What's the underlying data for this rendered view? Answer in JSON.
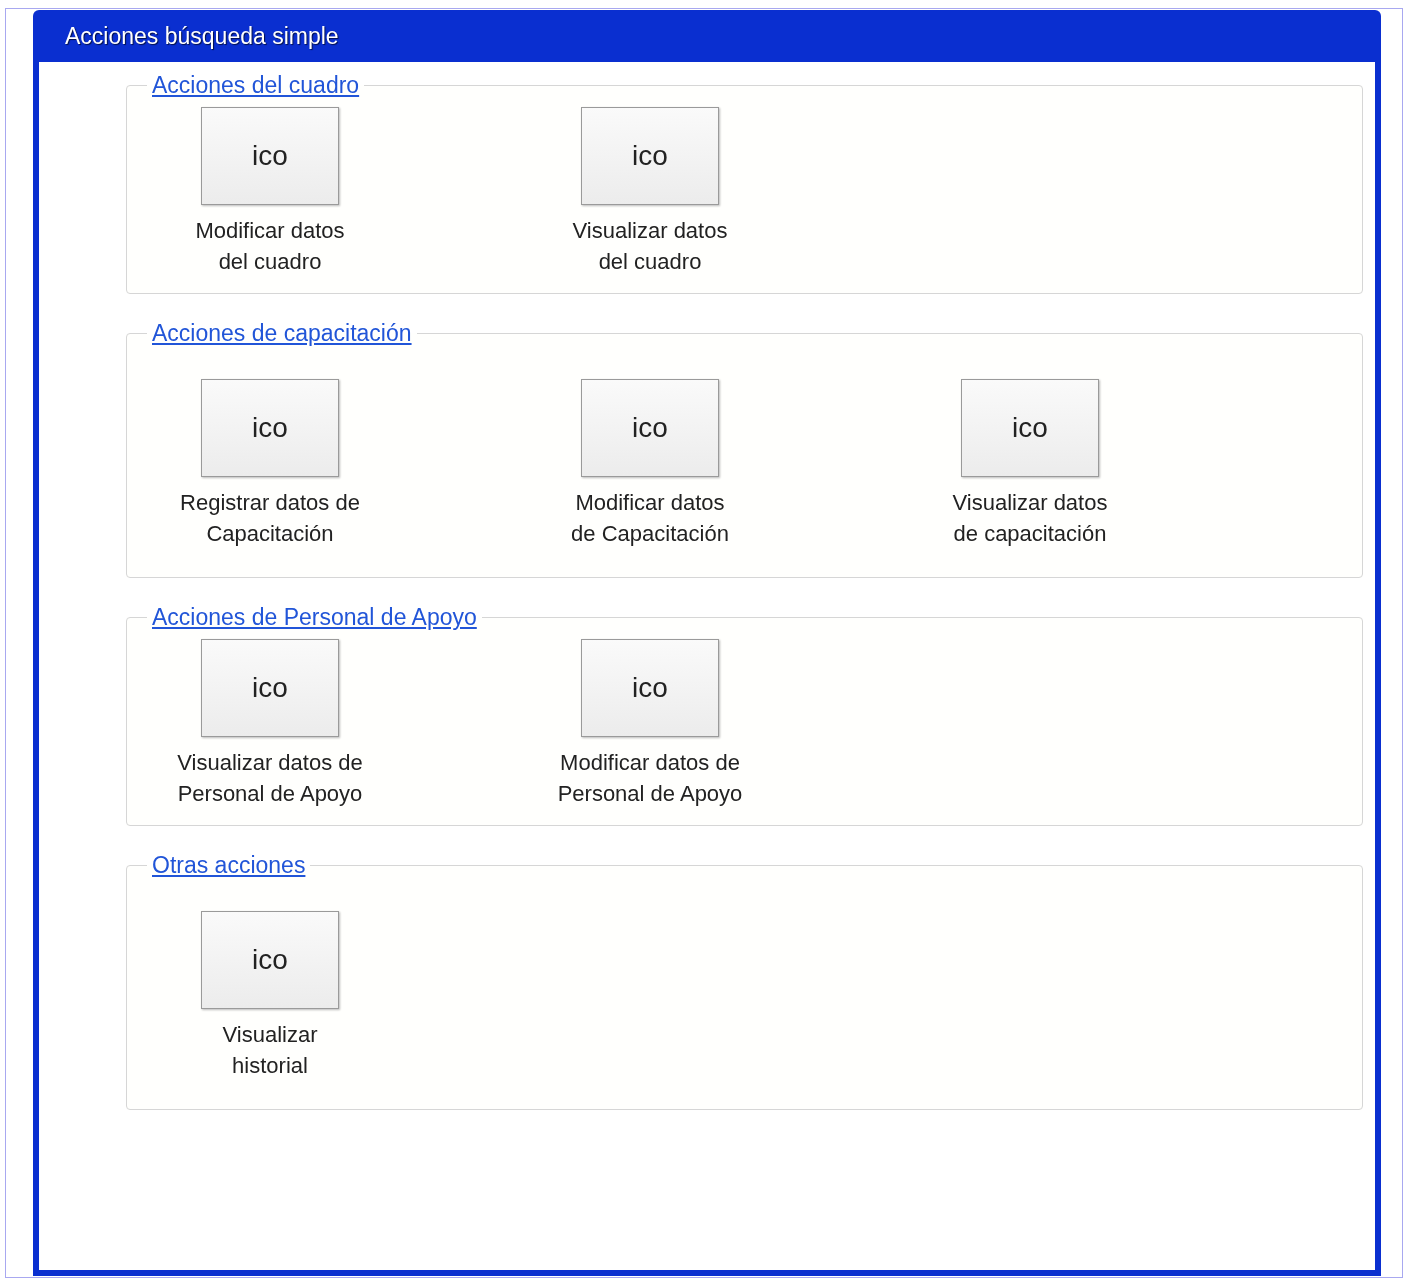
{
  "window": {
    "title": "Acciones búsqueda simple"
  },
  "sections": [
    {
      "title": "Acciones del cuadro",
      "actions": [
        {
          "icon_text": "ico",
          "label": "Modificar datos\ndel cuadro"
        },
        {
          "icon_text": "ico",
          "label": "Visualizar datos\ndel cuadro"
        }
      ]
    },
    {
      "title": "Acciones de capacitación",
      "actions": [
        {
          "icon_text": "ico",
          "label": "Registrar datos de\nCapacitación"
        },
        {
          "icon_text": "ico",
          "label": "Modificar datos\nde Capacitación"
        },
        {
          "icon_text": "ico",
          "label": "Visualizar datos\nde capacitación"
        }
      ]
    },
    {
      "title": "Acciones de Personal de Apoyo",
      "actions": [
        {
          "icon_text": "ico",
          "label": "Visualizar datos de\nPersonal de Apoyo"
        },
        {
          "icon_text": "ico",
          "label": "Modificar datos de\nPersonal de Apoyo"
        }
      ]
    },
    {
      "title": "Otras acciones",
      "actions": [
        {
          "icon_text": "ico",
          "label": "Visualizar\nhistorial"
        }
      ]
    }
  ]
}
